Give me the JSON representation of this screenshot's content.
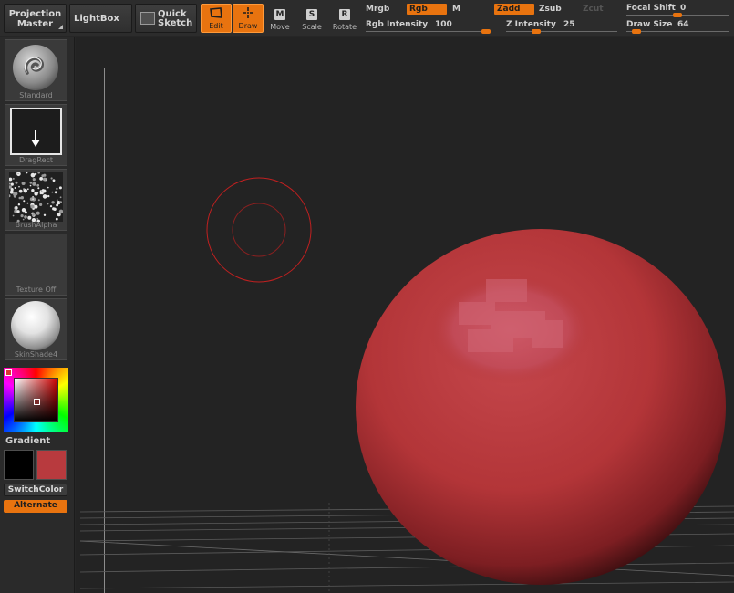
{
  "toolbar": {
    "projection_master": {
      "line1": "Projection",
      "line2": "Master"
    },
    "lightbox": "LightBox",
    "quick_sketch": {
      "line1": "Quick",
      "line2": "Sketch"
    },
    "tools": {
      "edit": "Edit",
      "draw": "Draw",
      "move": "Move",
      "move_key": "M",
      "scale": "Scale",
      "scale_key": "S",
      "rotate": "Rotate",
      "rotate_key": "R"
    },
    "modes": {
      "mrgb": "Mrgb",
      "rgb": "Rgb",
      "m": "M",
      "zadd": "Zadd",
      "zsub": "Zsub",
      "zcut": "Zcut"
    },
    "rgb_intensity": {
      "label": "Rgb Intensity",
      "value": "100",
      "level": 1.0
    },
    "z_intensity": {
      "label": "Z Intensity",
      "value": "25",
      "level": 0.25
    },
    "focal_shift": {
      "label": "Focal Shift",
      "value": "0",
      "level": 0.5
    },
    "draw_size": {
      "label": "Draw Size",
      "value": "64",
      "level": 0.06
    }
  },
  "tray": {
    "brush": "Standard",
    "stroke": "DragRect",
    "alpha": "BrushAlpha",
    "texture": "Texture Off",
    "material": "SkinShade4",
    "gradient_label": "Gradient",
    "switch_color": "SwitchColor",
    "alternate": "Alternate"
  },
  "colors": {
    "accent": "#e8730f",
    "main_color": "#b83a3e",
    "secondary_color": "#000000",
    "sphere": "#b8353a",
    "brush_cursor": "#c02020"
  }
}
